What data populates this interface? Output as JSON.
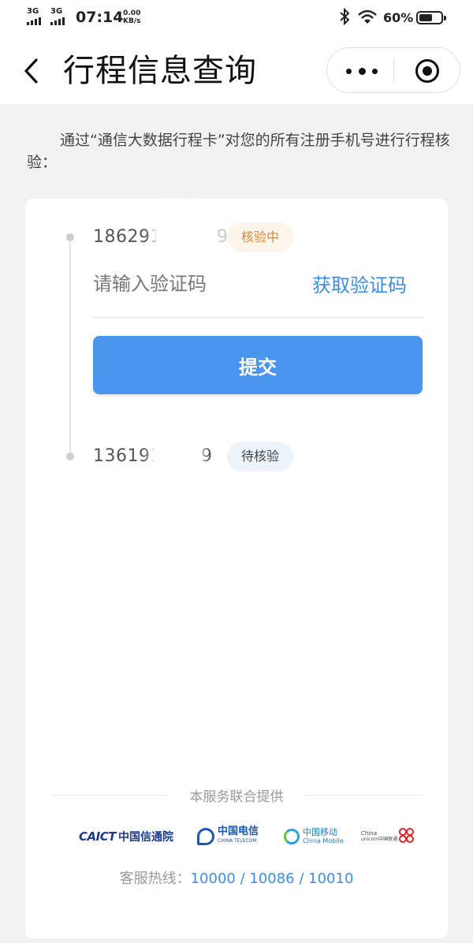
{
  "status_bar": {
    "signal_1_label": "3G",
    "signal_2_label": "3G",
    "time": "07:14",
    "net_rate_value": "0.00",
    "net_rate_unit": "KB/s",
    "battery_percent": "60%",
    "battery_level": 0.6,
    "icons": [
      "signal-icon",
      "bluetooth-icon",
      "wifi-icon",
      "battery-icon"
    ]
  },
  "header": {
    "title": "行程信息查询",
    "icons": [
      "back-icon",
      "more-icon",
      "close-mini-program-icon"
    ]
  },
  "intro_text": "通过“通信大数据行程卡”对您的所有注册手机号进行行程核验：",
  "phones": [
    {
      "number_start": "186291",
      "number_end": "9",
      "status": "核验中",
      "status_color": "#e08a3c"
    },
    {
      "number_start": "136191",
      "number_end": "9",
      "status": "待核验",
      "status_color": "#444444"
    }
  ],
  "verification": {
    "code_placeholder": "请输入验证码",
    "code_value": "",
    "get_code_label": "获取验证码",
    "submit_label": "提交"
  },
  "footer": {
    "provided_by": "本服务联合提供",
    "logos": [
      {
        "name": "caict",
        "text_en": "CAICT",
        "text_cn": "中国信通院"
      },
      {
        "name": "china-telecom",
        "text_cn": "中国电信",
        "text_en": "CHINA TELECOM"
      },
      {
        "name": "china-mobile",
        "text_cn": "中国移动",
        "text_en": "China Mobile"
      },
      {
        "name": "china-unicom",
        "text_en": "China",
        "text_en2": "unicom中国联通"
      }
    ],
    "hotline_label": "客服热线：",
    "hotline_numbers": "10000 / 10086 / 10010"
  },
  "colors": {
    "accent": "#4a96ef",
    "link": "#3a8ee6",
    "background": "#f2f2f2",
    "verifying_badge_bg": "#fdf4ea",
    "pending_badge_bg": "#eef4fb"
  }
}
